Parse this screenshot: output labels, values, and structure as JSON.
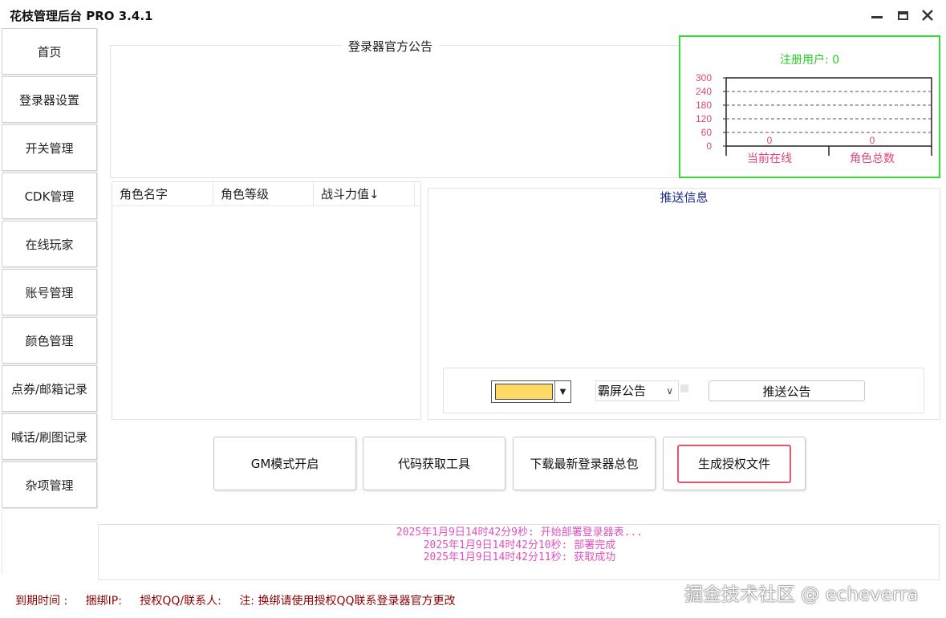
{
  "window": {
    "title": "花枝管理后台 PRO 3.4.1"
  },
  "sidebar": {
    "items": [
      {
        "label": "首页"
      },
      {
        "label": "登录器设置"
      },
      {
        "label": "开关管理"
      },
      {
        "label": "CDK管理"
      },
      {
        "label": "在线玩家"
      },
      {
        "label": "账号管理"
      },
      {
        "label": "颜色管理"
      },
      {
        "label": "点券/邮箱记录"
      },
      {
        "label": "喊话/刷图记录"
      },
      {
        "label": "杂项管理"
      }
    ]
  },
  "notice": {
    "title": "登录器官方公告"
  },
  "stats": {
    "title": "注册用户: 0"
  },
  "chart_data": {
    "type": "bar",
    "categories": [
      "当前在线",
      "角色总数"
    ],
    "values": [
      0,
      0
    ],
    "yticks": [
      300,
      240,
      180,
      120,
      60,
      0
    ],
    "ylim": [
      0,
      300
    ],
    "grid": true,
    "colors": {
      "border": "#33dd33",
      "title": "#22cc22",
      "axis_text": "#e0447c"
    }
  },
  "table": {
    "columns": [
      "角色名字",
      "角色等级",
      "战斗力值↓"
    ],
    "rows": []
  },
  "push": {
    "title": "推送信息",
    "color_value": "#ffd966",
    "mode_selected": "霸屏公告",
    "send_label": "推送公告"
  },
  "actions": {
    "gm_label": "GM模式开启",
    "code_tool_label": "代码获取工具",
    "download_label": "下载最新登录器总包",
    "license_label": "生成授权文件"
  },
  "log": {
    "lines": [
      "2025年1月9日14时42分9秒: 开始部署登录器表...",
      "2025年1月9日14时42分10秒: 部署完成",
      "2025年1月9日14时42分11秒: 获取成功"
    ]
  },
  "status": {
    "expire": "到期时间 :",
    "bind_ip": "捆绑IP:",
    "auth_qq": "授权QQ/联系人:",
    "note": "注: 换绑请使用授权QQ联系登录器官方更改"
  },
  "watermark": "掘金技术社区 @ echeverra"
}
